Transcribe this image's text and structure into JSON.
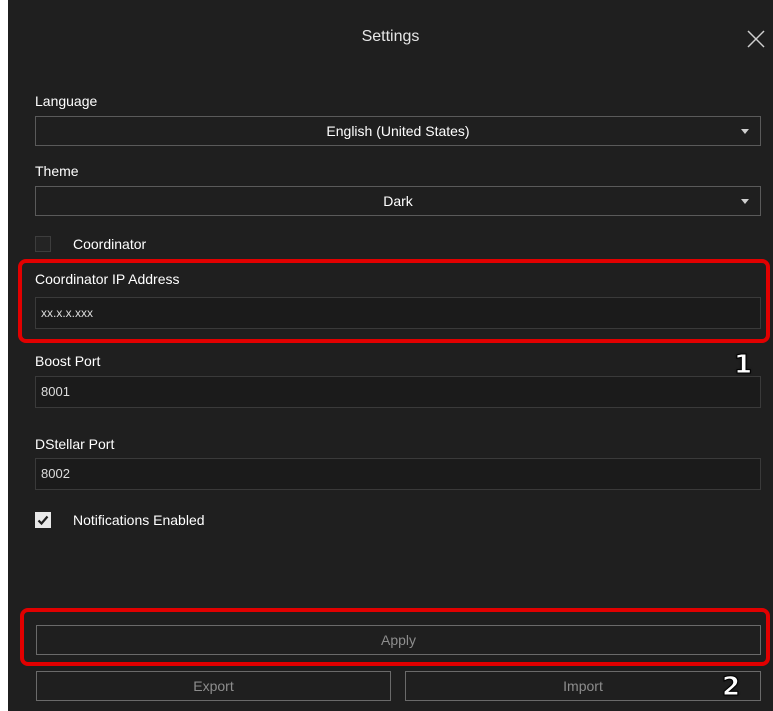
{
  "window": {
    "title": "Settings"
  },
  "language": {
    "label": "Language",
    "value": "English (United States)"
  },
  "theme": {
    "label": "Theme",
    "value": "Dark"
  },
  "coordinator": {
    "label": "Coordinator",
    "checked": false
  },
  "coordinator_ip": {
    "label": "Coordinator IP Address",
    "value": "xx.x.x.xxx"
  },
  "boost_port": {
    "label": "Boost Port",
    "value": "8001"
  },
  "dstellar_port": {
    "label": "DStellar Port",
    "value": "8002"
  },
  "notifications": {
    "label": "Notifications Enabled",
    "checked": true
  },
  "buttons": {
    "apply": "Apply",
    "export": "Export",
    "import": "Import"
  },
  "annotations": {
    "first": "1",
    "second": "2"
  },
  "colors": {
    "background": "#1f1f1f",
    "highlight": "#e10000"
  },
  "icons": {
    "close": "close-icon",
    "dropdown": "chevron-down-icon",
    "check": "check-icon"
  }
}
